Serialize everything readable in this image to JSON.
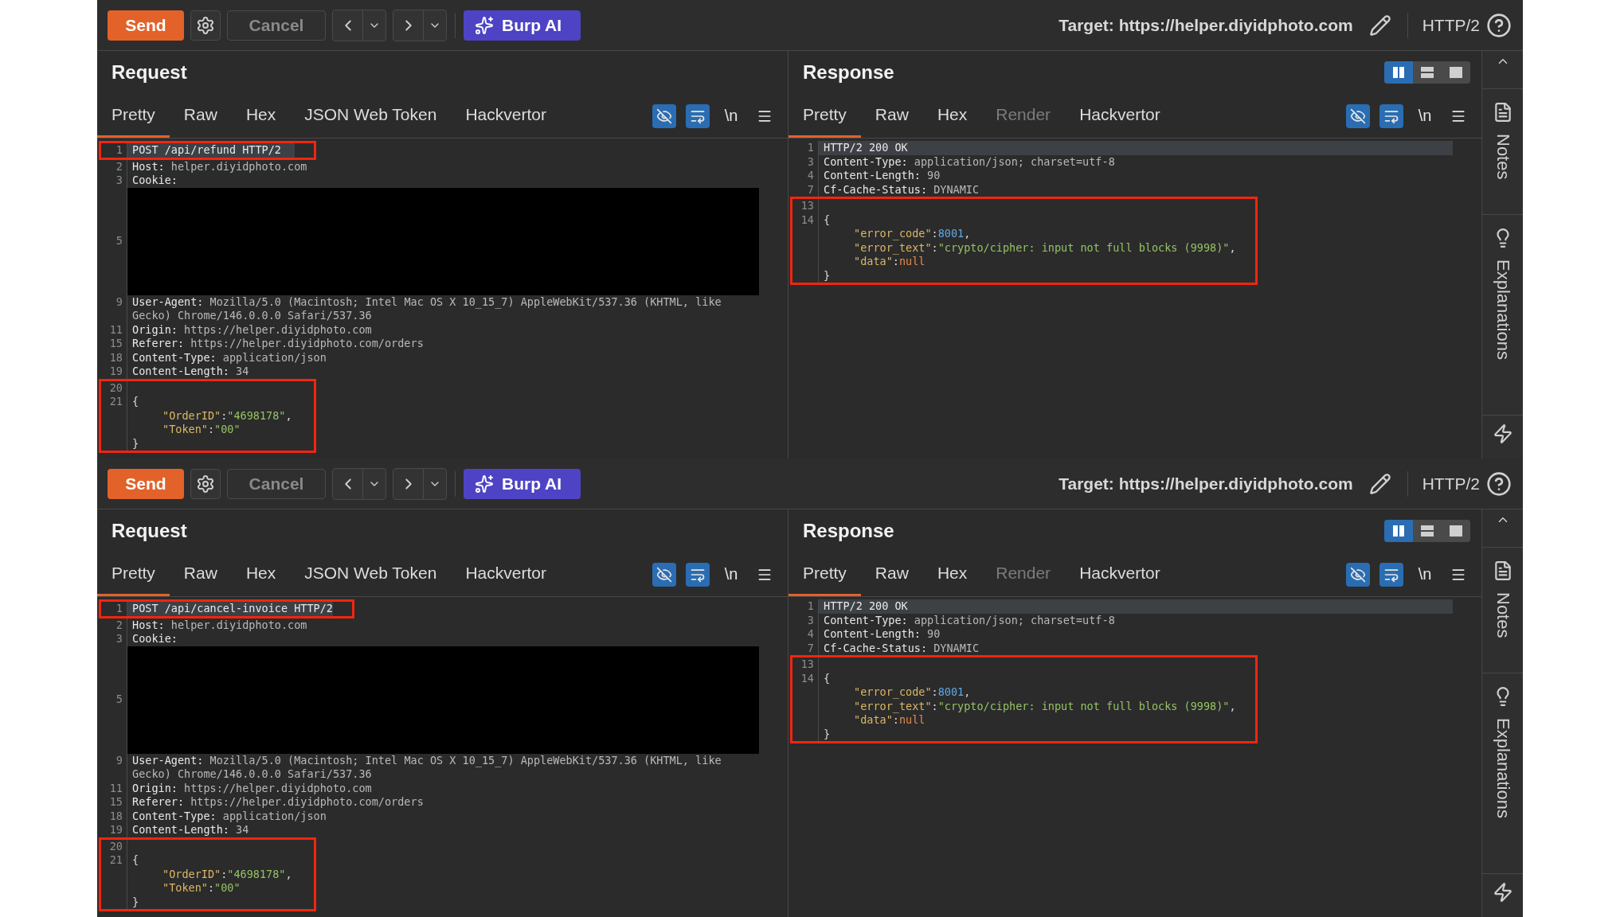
{
  "panes": [
    {
      "toolbar": {
        "send": "Send",
        "cancel": "Cancel",
        "ai": "Burp AI",
        "target": "Target: https://helper.diyidphoto.com",
        "protocol": "HTTP/2"
      },
      "request": {
        "title": "Request",
        "tabs": [
          {
            "label": "Pretty",
            "selected": true,
            "disabled": false
          },
          {
            "label": "Raw",
            "selected": false,
            "disabled": false
          },
          {
            "label": "Hex",
            "selected": false,
            "disabled": false
          },
          {
            "label": "JSON Web Token",
            "selected": false,
            "disabled": false
          },
          {
            "label": "Hackvertor",
            "selected": false,
            "disabled": false
          }
        ],
        "tools": [
          {
            "kind": "hide",
            "on": true
          },
          {
            "kind": "wrap",
            "on": true
          },
          {
            "kind": "newline",
            "label": "\\n",
            "on": false
          },
          {
            "kind": "menu",
            "on": false
          }
        ],
        "lines": [
          {
            "num": "1",
            "current": true,
            "boxed": true,
            "segs": [
              {
                "kind": "plain",
                "text": "POST /api/refund HTTP/2"
              }
            ]
          },
          {
            "num": "2",
            "current": false,
            "boxed": false,
            "segs": [
              {
                "kind": "header",
                "text": "Host: "
              },
              {
                "kind": "value",
                "text": "helper.diyidphoto.com"
              }
            ]
          },
          {
            "num": "3",
            "current": false,
            "boxed": false,
            "segs": [
              {
                "kind": "header",
                "text": "Cookie:"
              }
            ]
          },
          {
            "num": "5",
            "kind": "redacted",
            "current": false,
            "boxed": false
          },
          {
            "num": "9",
            "current": false,
            "boxed": false,
            "segs": [
              {
                "kind": "header",
                "text": "User-Agent: "
              },
              {
                "kind": "value",
                "text": "Mozilla/5.0 (Macintosh; Intel Mac OS X 10_15_7) AppleWebKit/537.36 (KHTML, like Gecko) Chrome/146.0.0.0 Safari/537.36"
              }
            ]
          },
          {
            "num": "11",
            "current": false,
            "boxed": false,
            "segs": [
              {
                "kind": "header",
                "text": "Origin: "
              },
              {
                "kind": "value",
                "text": "https://helper.diyidphoto.com"
              }
            ]
          },
          {
            "num": "15",
            "current": false,
            "boxed": false,
            "segs": [
              {
                "kind": "header",
                "text": "Referer: "
              },
              {
                "kind": "value",
                "text": "https://helper.diyidphoto.com/orders"
              }
            ]
          },
          {
            "num": "18",
            "current": false,
            "boxed": false,
            "segs": [
              {
                "kind": "header",
                "text": "Content-Type: "
              },
              {
                "kind": "value",
                "text": "application/json"
              }
            ]
          },
          {
            "num": "19",
            "current": false,
            "boxed": false,
            "segs": [
              {
                "kind": "header",
                "text": "Content-Length: "
              },
              {
                "kind": "value",
                "text": "34"
              }
            ]
          },
          {
            "num": "20",
            "current": false,
            "boxed": true
          },
          {
            "num": "21",
            "current": false,
            "boxed": true,
            "segs": [
              {
                "kind": "punct",
                "text": "{"
              }
            ]
          },
          {
            "current": false,
            "boxed": true,
            "indented": true,
            "segs": [
              {
                "kind": "key",
                "text": "\"OrderID\""
              },
              {
                "kind": "punct",
                "text": ":"
              },
              {
                "kind": "string",
                "text": "\"4698178\""
              },
              {
                "kind": "punct",
                "text": ","
              }
            ]
          },
          {
            "current": false,
            "boxed": true,
            "indented": true,
            "segs": [
              {
                "kind": "key",
                "text": "\"Token\""
              },
              {
                "kind": "punct",
                "text": ":"
              },
              {
                "kind": "string",
                "text": "\"00\""
              }
            ]
          },
          {
            "current": false,
            "boxed": true,
            "segs": [
              {
                "kind": "punct",
                "text": "}"
              }
            ]
          }
        ]
      },
      "response": {
        "title": "Response",
        "layout": [
          {
            "kind": "split",
            "selected": true
          },
          {
            "kind": "stacked",
            "selected": false
          },
          {
            "kind": "single",
            "selected": false
          }
        ],
        "tabs": [
          {
            "label": "Pretty",
            "selected": true,
            "disabled": false
          },
          {
            "label": "Raw",
            "selected": false,
            "disabled": false
          },
          {
            "label": "Hex",
            "selected": false,
            "disabled": false
          },
          {
            "label": "Render",
            "selected": false,
            "disabled": true
          },
          {
            "label": "Hackvertor",
            "selected": false,
            "disabled": false
          }
        ],
        "tools": [
          {
            "kind": "hide",
            "on": true
          },
          {
            "kind": "wrap",
            "on": true
          },
          {
            "kind": "newline",
            "label": "\\n",
            "on": false
          },
          {
            "kind": "menu",
            "on": false
          }
        ],
        "lines": [
          {
            "num": "1",
            "current": true,
            "boxed": false,
            "segs": [
              {
                "kind": "plain",
                "text": "HTTP/2 200 OK"
              }
            ]
          },
          {
            "num": "3",
            "current": false,
            "boxed": false,
            "segs": [
              {
                "kind": "header",
                "text": "Content-Type: "
              },
              {
                "kind": "value",
                "text": "application/json; charset=utf-8"
              }
            ]
          },
          {
            "num": "4",
            "current": false,
            "boxed": false,
            "segs": [
              {
                "kind": "header",
                "text": "Content-Length: "
              },
              {
                "kind": "value",
                "text": "90"
              }
            ]
          },
          {
            "num": "7",
            "current": false,
            "boxed": false,
            "segs": [
              {
                "kind": "header",
                "text": "Cf-Cache-Status: "
              },
              {
                "kind": "value",
                "text": "DYNAMIC"
              }
            ]
          },
          {
            "num": "13",
            "current": false,
            "boxed": true
          },
          {
            "num": "14",
            "current": false,
            "boxed": true,
            "segs": [
              {
                "kind": "punct",
                "text": "{"
              }
            ]
          },
          {
            "current": false,
            "boxed": true,
            "indented": true,
            "segs": [
              {
                "kind": "key",
                "text": "\"error_code\""
              },
              {
                "kind": "punct",
                "text": ":"
              },
              {
                "kind": "number",
                "text": "8001"
              },
              {
                "kind": "punct",
                "text": ","
              }
            ]
          },
          {
            "current": false,
            "boxed": true,
            "indented": true,
            "segs": [
              {
                "kind": "key",
                "text": "\"error_text\""
              },
              {
                "kind": "punct",
                "text": ":"
              },
              {
                "kind": "string",
                "text": "\"crypto/cipher: input not full blocks (9998)\""
              },
              {
                "kind": "punct",
                "text": ","
              }
            ]
          },
          {
            "current": false,
            "boxed": true,
            "indented": true,
            "segs": [
              {
                "kind": "key",
                "text": "\"data\""
              },
              {
                "kind": "punct",
                "text": ":"
              },
              {
                "kind": "null",
                "text": "null"
              }
            ]
          },
          {
            "current": false,
            "boxed": true,
            "segs": [
              {
                "kind": "punct",
                "text": "}"
              }
            ]
          }
        ]
      },
      "sidebar": [
        {
          "kind": "collapse"
        },
        {
          "kind": "notes",
          "label": "Notes"
        },
        {
          "kind": "explanations",
          "label": "Explanations"
        },
        {
          "kind": "actions"
        }
      ]
    },
    {
      "toolbar": {
        "send": "Send",
        "cancel": "Cancel",
        "ai": "Burp AI",
        "target": "Target: https://helper.diyidphoto.com",
        "protocol": "HTTP/2"
      },
      "request": {
        "title": "Request",
        "tabs": [
          {
            "label": "Pretty",
            "selected": true,
            "disabled": false
          },
          {
            "label": "Raw",
            "selected": false,
            "disabled": false
          },
          {
            "label": "Hex",
            "selected": false,
            "disabled": false
          },
          {
            "label": "JSON Web Token",
            "selected": false,
            "disabled": false
          },
          {
            "label": "Hackvertor",
            "selected": false,
            "disabled": false
          }
        ],
        "tools": [
          {
            "kind": "hide",
            "on": true
          },
          {
            "kind": "wrap",
            "on": true
          },
          {
            "kind": "newline",
            "label": "\\n",
            "on": false
          },
          {
            "kind": "menu",
            "on": false
          }
        ],
        "lines": [
          {
            "num": "1",
            "current": true,
            "boxed": true,
            "segs": [
              {
                "kind": "plain",
                "text": "POST /api/cancel-invoice HTTP/2"
              }
            ]
          },
          {
            "num": "2",
            "current": false,
            "boxed": false,
            "segs": [
              {
                "kind": "header",
                "text": "Host: "
              },
              {
                "kind": "value",
                "text": "helper.diyidphoto.com"
              }
            ]
          },
          {
            "num": "3",
            "current": false,
            "boxed": false,
            "segs": [
              {
                "kind": "header",
                "text": "Cookie:"
              }
            ]
          },
          {
            "num": "5",
            "kind": "redacted",
            "current": false,
            "boxed": false
          },
          {
            "num": "9",
            "current": false,
            "boxed": false,
            "segs": [
              {
                "kind": "header",
                "text": "User-Agent: "
              },
              {
                "kind": "value",
                "text": "Mozilla/5.0 (Macintosh; Intel Mac OS X 10_15_7) AppleWebKit/537.36 (KHTML, like Gecko) Chrome/146.0.0.0 Safari/537.36"
              }
            ]
          },
          {
            "num": "11",
            "current": false,
            "boxed": false,
            "segs": [
              {
                "kind": "header",
                "text": "Origin: "
              },
              {
                "kind": "value",
                "text": "https://helper.diyidphoto.com"
              }
            ]
          },
          {
            "num": "15",
            "current": false,
            "boxed": false,
            "segs": [
              {
                "kind": "header",
                "text": "Referer: "
              },
              {
                "kind": "value",
                "text": "https://helper.diyidphoto.com/orders"
              }
            ]
          },
          {
            "num": "18",
            "current": false,
            "boxed": false,
            "segs": [
              {
                "kind": "header",
                "text": "Content-Type: "
              },
              {
                "kind": "value",
                "text": "application/json"
              }
            ]
          },
          {
            "num": "19",
            "current": false,
            "boxed": false,
            "segs": [
              {
                "kind": "header",
                "text": "Content-Length: "
              },
              {
                "kind": "value",
                "text": "34"
              }
            ]
          },
          {
            "num": "20",
            "current": false,
            "boxed": true
          },
          {
            "num": "21",
            "current": false,
            "boxed": true,
            "segs": [
              {
                "kind": "punct",
                "text": "{"
              }
            ]
          },
          {
            "current": false,
            "boxed": true,
            "indented": true,
            "segs": [
              {
                "kind": "key",
                "text": "\"OrderID\""
              },
              {
                "kind": "punct",
                "text": ":"
              },
              {
                "kind": "string",
                "text": "\"4698178\""
              },
              {
                "kind": "punct",
                "text": ","
              }
            ]
          },
          {
            "current": false,
            "boxed": true,
            "indented": true,
            "segs": [
              {
                "kind": "key",
                "text": "\"Token\""
              },
              {
                "kind": "punct",
                "text": ":"
              },
              {
                "kind": "string",
                "text": "\"00\""
              }
            ]
          },
          {
            "current": false,
            "boxed": true,
            "segs": [
              {
                "kind": "punct",
                "text": "}"
              }
            ]
          }
        ]
      },
      "response": {
        "title": "Response",
        "layout": [
          {
            "kind": "split",
            "selected": true
          },
          {
            "kind": "stacked",
            "selected": false
          },
          {
            "kind": "single",
            "selected": false
          }
        ],
        "tabs": [
          {
            "label": "Pretty",
            "selected": true,
            "disabled": false
          },
          {
            "label": "Raw",
            "selected": false,
            "disabled": false
          },
          {
            "label": "Hex",
            "selected": false,
            "disabled": false
          },
          {
            "label": "Render",
            "selected": false,
            "disabled": true
          },
          {
            "label": "Hackvertor",
            "selected": false,
            "disabled": false
          }
        ],
        "tools": [
          {
            "kind": "hide",
            "on": true
          },
          {
            "kind": "wrap",
            "on": true
          },
          {
            "kind": "newline",
            "label": "\\n",
            "on": false
          },
          {
            "kind": "menu",
            "on": false
          }
        ],
        "lines": [
          {
            "num": "1",
            "current": true,
            "boxed": false,
            "segs": [
              {
                "kind": "plain",
                "text": "HTTP/2 200 OK"
              }
            ]
          },
          {
            "num": "3",
            "current": false,
            "boxed": false,
            "segs": [
              {
                "kind": "header",
                "text": "Content-Type: "
              },
              {
                "kind": "value",
                "text": "application/json; charset=utf-8"
              }
            ]
          },
          {
            "num": "4",
            "current": false,
            "boxed": false,
            "segs": [
              {
                "kind": "header",
                "text": "Content-Length: "
              },
              {
                "kind": "value",
                "text": "90"
              }
            ]
          },
          {
            "num": "7",
            "current": false,
            "boxed": false,
            "segs": [
              {
                "kind": "header",
                "text": "Cf-Cache-Status: "
              },
              {
                "kind": "value",
                "text": "DYNAMIC"
              }
            ]
          },
          {
            "num": "13",
            "current": false,
            "boxed": true
          },
          {
            "num": "14",
            "current": false,
            "boxed": true,
            "segs": [
              {
                "kind": "punct",
                "text": "{"
              }
            ]
          },
          {
            "current": false,
            "boxed": true,
            "indented": true,
            "segs": [
              {
                "kind": "key",
                "text": "\"error_code\""
              },
              {
                "kind": "punct",
                "text": ":"
              },
              {
                "kind": "number",
                "text": "8001"
              },
              {
                "kind": "punct",
                "text": ","
              }
            ]
          },
          {
            "current": false,
            "boxed": true,
            "indented": true,
            "segs": [
              {
                "kind": "key",
                "text": "\"error_text\""
              },
              {
                "kind": "punct",
                "text": ":"
              },
              {
                "kind": "string",
                "text": "\"crypto/cipher: input not full blocks (9998)\""
              },
              {
                "kind": "punct",
                "text": ","
              }
            ]
          },
          {
            "current": false,
            "boxed": true,
            "indented": true,
            "segs": [
              {
                "kind": "key",
                "text": "\"data\""
              },
              {
                "kind": "punct",
                "text": ":"
              },
              {
                "kind": "null",
                "text": "null"
              }
            ]
          },
          {
            "current": false,
            "boxed": true,
            "segs": [
              {
                "kind": "punct",
                "text": "}"
              }
            ]
          }
        ]
      },
      "sidebar": [
        {
          "kind": "collapse"
        },
        {
          "kind": "notes",
          "label": "Notes"
        },
        {
          "kind": "explanations",
          "label": "Explanations"
        },
        {
          "kind": "actions"
        }
      ]
    }
  ]
}
